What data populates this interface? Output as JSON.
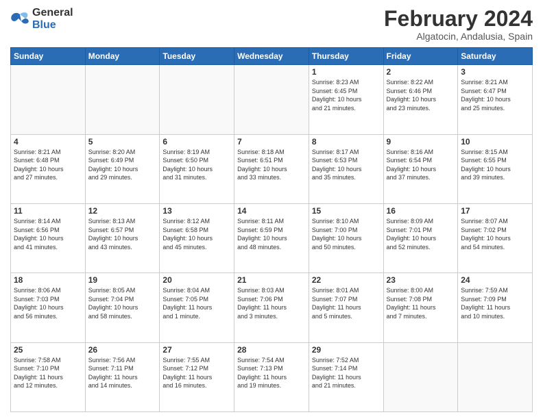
{
  "logo": {
    "line1": "General",
    "line2": "Blue"
  },
  "title": "February 2024",
  "location": "Algatocin, Andalusia, Spain",
  "weekdays": [
    "Sunday",
    "Monday",
    "Tuesday",
    "Wednesday",
    "Thursday",
    "Friday",
    "Saturday"
  ],
  "weeks": [
    [
      {
        "day": "",
        "info": ""
      },
      {
        "day": "",
        "info": ""
      },
      {
        "day": "",
        "info": ""
      },
      {
        "day": "",
        "info": ""
      },
      {
        "day": "1",
        "info": "Sunrise: 8:23 AM\nSunset: 6:45 PM\nDaylight: 10 hours\nand 21 minutes."
      },
      {
        "day": "2",
        "info": "Sunrise: 8:22 AM\nSunset: 6:46 PM\nDaylight: 10 hours\nand 23 minutes."
      },
      {
        "day": "3",
        "info": "Sunrise: 8:21 AM\nSunset: 6:47 PM\nDaylight: 10 hours\nand 25 minutes."
      }
    ],
    [
      {
        "day": "4",
        "info": "Sunrise: 8:21 AM\nSunset: 6:48 PM\nDaylight: 10 hours\nand 27 minutes."
      },
      {
        "day": "5",
        "info": "Sunrise: 8:20 AM\nSunset: 6:49 PM\nDaylight: 10 hours\nand 29 minutes."
      },
      {
        "day": "6",
        "info": "Sunrise: 8:19 AM\nSunset: 6:50 PM\nDaylight: 10 hours\nand 31 minutes."
      },
      {
        "day": "7",
        "info": "Sunrise: 8:18 AM\nSunset: 6:51 PM\nDaylight: 10 hours\nand 33 minutes."
      },
      {
        "day": "8",
        "info": "Sunrise: 8:17 AM\nSunset: 6:53 PM\nDaylight: 10 hours\nand 35 minutes."
      },
      {
        "day": "9",
        "info": "Sunrise: 8:16 AM\nSunset: 6:54 PM\nDaylight: 10 hours\nand 37 minutes."
      },
      {
        "day": "10",
        "info": "Sunrise: 8:15 AM\nSunset: 6:55 PM\nDaylight: 10 hours\nand 39 minutes."
      }
    ],
    [
      {
        "day": "11",
        "info": "Sunrise: 8:14 AM\nSunset: 6:56 PM\nDaylight: 10 hours\nand 41 minutes."
      },
      {
        "day": "12",
        "info": "Sunrise: 8:13 AM\nSunset: 6:57 PM\nDaylight: 10 hours\nand 43 minutes."
      },
      {
        "day": "13",
        "info": "Sunrise: 8:12 AM\nSunset: 6:58 PM\nDaylight: 10 hours\nand 45 minutes."
      },
      {
        "day": "14",
        "info": "Sunrise: 8:11 AM\nSunset: 6:59 PM\nDaylight: 10 hours\nand 48 minutes."
      },
      {
        "day": "15",
        "info": "Sunrise: 8:10 AM\nSunset: 7:00 PM\nDaylight: 10 hours\nand 50 minutes."
      },
      {
        "day": "16",
        "info": "Sunrise: 8:09 AM\nSunset: 7:01 PM\nDaylight: 10 hours\nand 52 minutes."
      },
      {
        "day": "17",
        "info": "Sunrise: 8:07 AM\nSunset: 7:02 PM\nDaylight: 10 hours\nand 54 minutes."
      }
    ],
    [
      {
        "day": "18",
        "info": "Sunrise: 8:06 AM\nSunset: 7:03 PM\nDaylight: 10 hours\nand 56 minutes."
      },
      {
        "day": "19",
        "info": "Sunrise: 8:05 AM\nSunset: 7:04 PM\nDaylight: 10 hours\nand 58 minutes."
      },
      {
        "day": "20",
        "info": "Sunrise: 8:04 AM\nSunset: 7:05 PM\nDaylight: 11 hours\nand 1 minute."
      },
      {
        "day": "21",
        "info": "Sunrise: 8:03 AM\nSunset: 7:06 PM\nDaylight: 11 hours\nand 3 minutes."
      },
      {
        "day": "22",
        "info": "Sunrise: 8:01 AM\nSunset: 7:07 PM\nDaylight: 11 hours\nand 5 minutes."
      },
      {
        "day": "23",
        "info": "Sunrise: 8:00 AM\nSunset: 7:08 PM\nDaylight: 11 hours\nand 7 minutes."
      },
      {
        "day": "24",
        "info": "Sunrise: 7:59 AM\nSunset: 7:09 PM\nDaylight: 11 hours\nand 10 minutes."
      }
    ],
    [
      {
        "day": "25",
        "info": "Sunrise: 7:58 AM\nSunset: 7:10 PM\nDaylight: 11 hours\nand 12 minutes."
      },
      {
        "day": "26",
        "info": "Sunrise: 7:56 AM\nSunset: 7:11 PM\nDaylight: 11 hours\nand 14 minutes."
      },
      {
        "day": "27",
        "info": "Sunrise: 7:55 AM\nSunset: 7:12 PM\nDaylight: 11 hours\nand 16 minutes."
      },
      {
        "day": "28",
        "info": "Sunrise: 7:54 AM\nSunset: 7:13 PM\nDaylight: 11 hours\nand 19 minutes."
      },
      {
        "day": "29",
        "info": "Sunrise: 7:52 AM\nSunset: 7:14 PM\nDaylight: 11 hours\nand 21 minutes."
      },
      {
        "day": "",
        "info": ""
      },
      {
        "day": "",
        "info": ""
      }
    ]
  ]
}
